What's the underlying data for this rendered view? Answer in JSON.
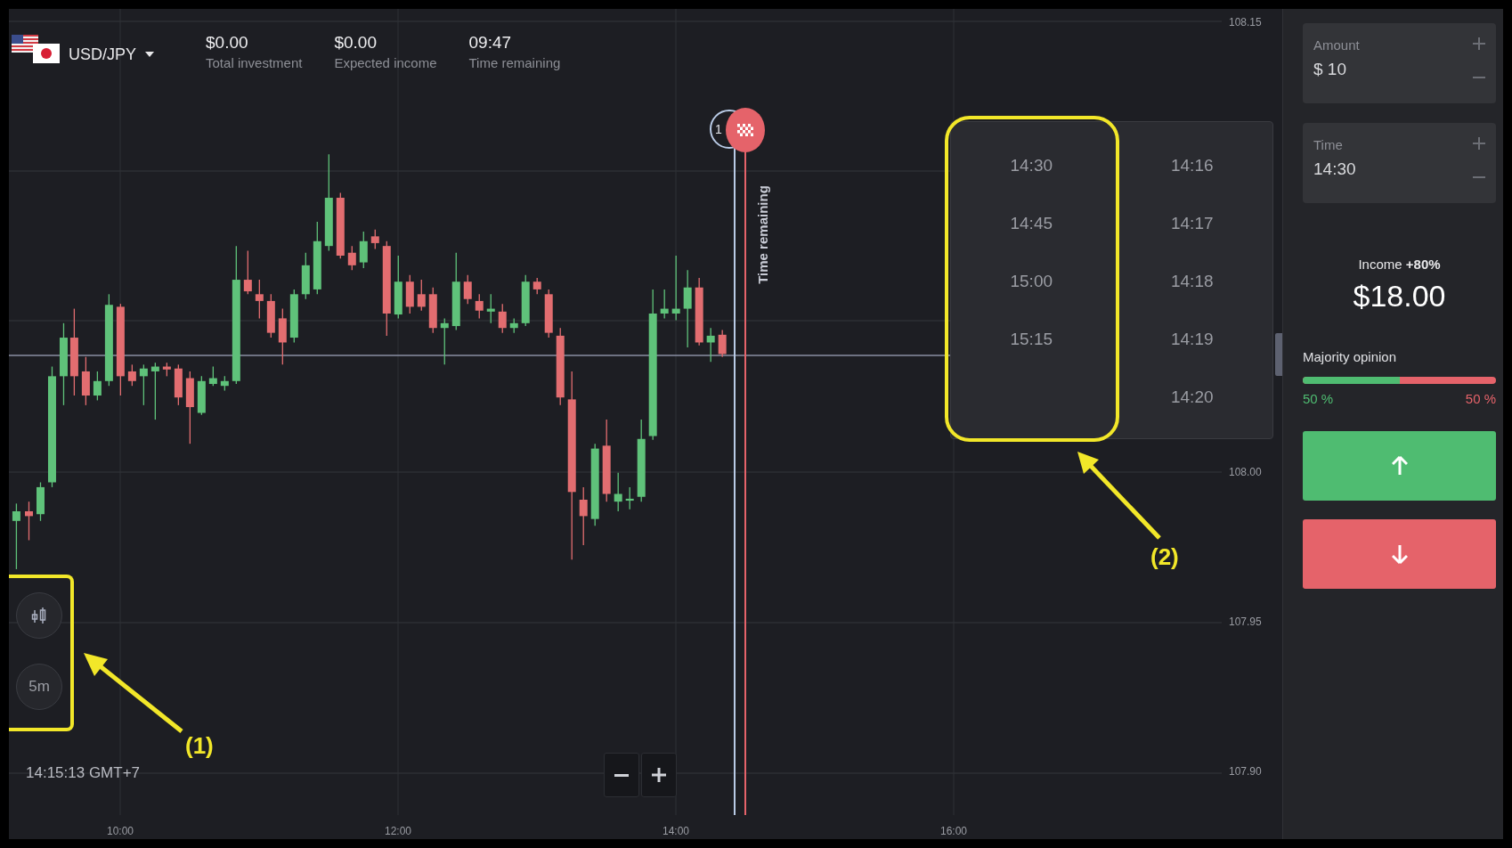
{
  "header": {
    "pair": "USD/JPY",
    "stats": [
      {
        "value": "$0.00",
        "label": "Total investment"
      },
      {
        "value": "$0.00",
        "label": "Expected income"
      },
      {
        "value": "09:47",
        "label": "Time remaining"
      }
    ]
  },
  "chart": {
    "y_ticks": [
      "108.15",
      "108.00",
      "107.95",
      "107.90"
    ],
    "x_ticks": [
      "10:00",
      "12:00",
      "14:00",
      "16:00"
    ],
    "expiry_marker": {
      "badge": "1",
      "label": "Time remaining"
    },
    "clock": "14:15:13 GMT+7",
    "tools": [
      {
        "kind": "chart-type"
      },
      {
        "kind": "interval",
        "label": "5m"
      }
    ]
  },
  "time_dropdown": {
    "columns": [
      [
        "14:30",
        "14:45",
        "15:00",
        "15:15"
      ],
      [
        "14:16",
        "14:17",
        "14:18",
        "14:19",
        "14:20"
      ]
    ]
  },
  "annotations": [
    {
      "label": "(1)"
    },
    {
      "label": "(2)"
    }
  ],
  "sidebar": {
    "fields": [
      {
        "label": "Amount",
        "value": "$ 10"
      },
      {
        "label": "Time",
        "value": "14:30"
      }
    ],
    "income": {
      "label": "Income **+80%**",
      "amount": "$18.00"
    },
    "majority": {
      "title": "Majority opinion",
      "level": 0.5,
      "up": "50 %",
      "down": "50 %"
    }
  }
}
